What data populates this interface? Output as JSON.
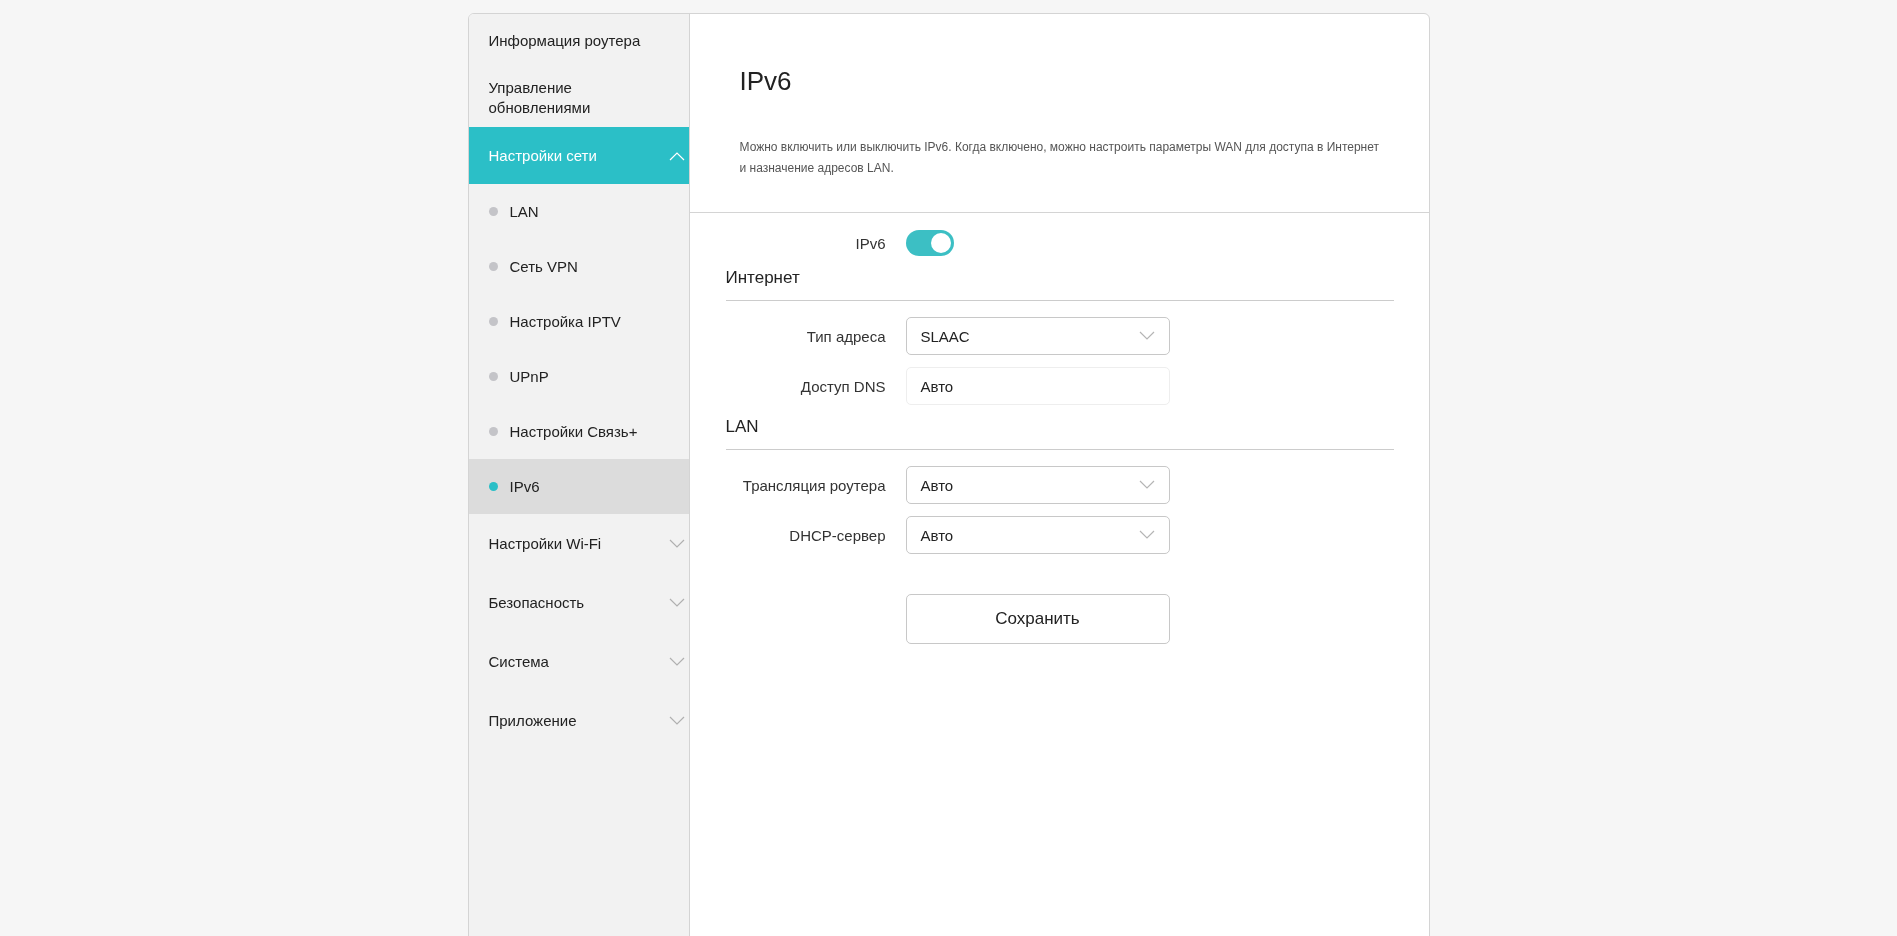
{
  "sidebar": {
    "items": [
      {
        "label": "Информация роутера",
        "kind": "link",
        "selected": false
      },
      {
        "label": "Управление обновлениями",
        "kind": "link",
        "selected": false
      },
      {
        "label": "Настройки сети",
        "kind": "group",
        "selected": true,
        "expanded": true,
        "children": [
          {
            "label": "LAN",
            "selected": false
          },
          {
            "label": "Сеть VPN",
            "selected": false
          },
          {
            "label": "Настройка IPTV",
            "selected": false
          },
          {
            "label": "UPnP",
            "selected": false
          },
          {
            "label": "Настройки Связь+",
            "selected": false
          },
          {
            "label": "IPv6",
            "selected": true
          }
        ]
      },
      {
        "label": "Настройки Wi-Fi",
        "kind": "group",
        "selected": false,
        "expanded": false
      },
      {
        "label": "Безопасность",
        "kind": "group",
        "selected": false,
        "expanded": false
      },
      {
        "label": "Система",
        "kind": "group",
        "selected": false,
        "expanded": false
      },
      {
        "label": "Приложение",
        "kind": "group",
        "selected": false,
        "expanded": false
      }
    ]
  },
  "header": {
    "title": "IPv6",
    "description": "Можно включить или выключить IPv6. Когда включено, можно настроить параметры WAN для доступа в Интернет и назначение адресов LAN."
  },
  "toggle": {
    "label": "IPv6",
    "on": true
  },
  "sections": [
    {
      "title": "Интернет",
      "fields": [
        {
          "label": "Тип адреса",
          "kind": "select",
          "value": "SLAAC"
        },
        {
          "label": "Доступ DNS",
          "kind": "text",
          "value": "Авто"
        }
      ]
    },
    {
      "title": "LAN",
      "fields": [
        {
          "label": "Трансляция роутера",
          "kind": "select",
          "value": "Авто"
        },
        {
          "label": "DHCP-сервер",
          "kind": "select",
          "value": "Авто"
        }
      ]
    }
  ],
  "save_button": "Сохранить"
}
